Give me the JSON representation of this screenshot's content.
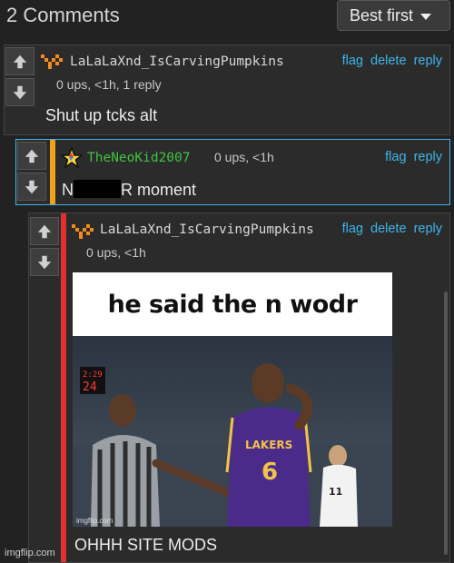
{
  "header": {
    "comment_count": "2 Comments",
    "sort_label": "Best first"
  },
  "comments": [
    {
      "username": "LaLaLaXnd_IsCarvingPumpkins",
      "meta": "0 ups, <1h, 1 reply",
      "actions": {
        "flag": "flag",
        "delete": "delete",
        "reply": "reply"
      },
      "text": "Shut up tcks alt"
    },
    {
      "username": "TheNeoKid2007",
      "meta": "0 ups, <1h",
      "actions": {
        "flag": "flag",
        "reply": "reply"
      },
      "text_before": "N",
      "text_after": "R moment",
      "username_color": "#3ec53e",
      "accent_color": "#f0a020"
    },
    {
      "username": "LaLaLaXnd_IsCarvingPumpkins",
      "meta": "0 ups, <1h",
      "actions": {
        "flag": "flag",
        "delete": "delete",
        "reply": "reply"
      },
      "meme_caption": "he said the n wodr",
      "meme_credit": "imgflip.com",
      "scoreboard": {
        "clock": "2:29",
        "shot_clock": "24"
      },
      "jersey_number": "6",
      "jersey_team": "LAKERS",
      "opponent_jersey": "11",
      "text": "OHHH SITE MODS",
      "accent_color": "#e03030"
    }
  ],
  "footer": {
    "watermark": "imgflip.com"
  },
  "colors": {
    "link": "#3fb5e8",
    "background": "#222222",
    "panel": "#2b2b2b"
  }
}
